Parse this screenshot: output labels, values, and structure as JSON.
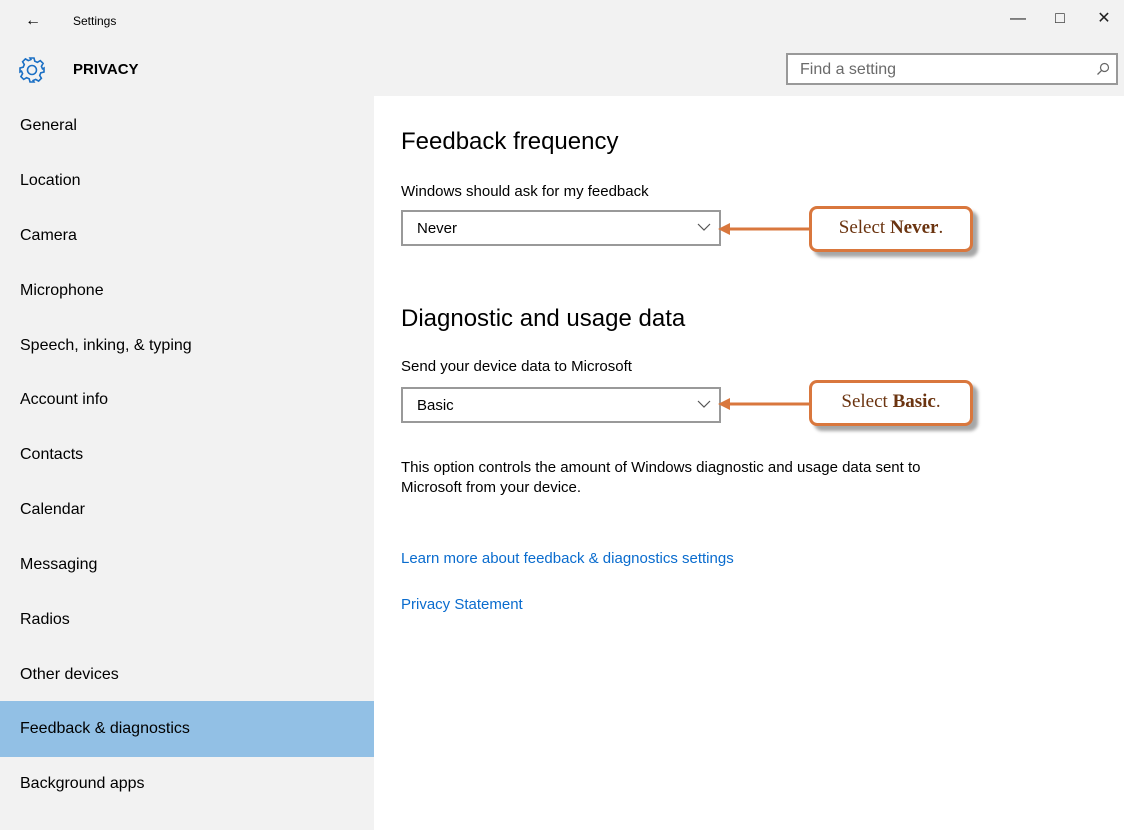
{
  "window": {
    "title": "Settings",
    "back_icon": "←",
    "minimize_icon": "—",
    "maximize_icon": "□",
    "close_icon": "✕"
  },
  "header": {
    "icon": "gear-icon",
    "title": "PRIVACY",
    "search": {
      "placeholder": "Find a setting",
      "icon": "search-icon"
    }
  },
  "sidebar": {
    "items": [
      {
        "label": "General"
      },
      {
        "label": "Location"
      },
      {
        "label": "Camera"
      },
      {
        "label": "Microphone"
      },
      {
        "label": "Speech, inking, & typing"
      },
      {
        "label": "Account info"
      },
      {
        "label": "Contacts"
      },
      {
        "label": "Calendar"
      },
      {
        "label": "Messaging"
      },
      {
        "label": "Radios"
      },
      {
        "label": "Other devices"
      },
      {
        "label": "Feedback & diagnostics",
        "selected": true
      },
      {
        "label": "Background apps"
      }
    ]
  },
  "main": {
    "feedback": {
      "heading": "Feedback frequency",
      "label": "Windows should ask for my feedback",
      "value": "Never"
    },
    "diagnostics": {
      "heading": "Diagnostic and usage data",
      "label": "Send your device data to Microsoft",
      "value": "Basic",
      "description": "This option controls the amount of Windows diagnostic and usage data sent to Microsoft from your device."
    },
    "links": {
      "learn_more": "Learn more about feedback & diagnostics settings",
      "privacy": "Privacy Statement"
    }
  },
  "callouts": {
    "never": {
      "prefix": "Select ",
      "bold": "Never",
      "suffix": "."
    },
    "basic": {
      "prefix": "Select ",
      "bold": "Basic",
      "suffix": "."
    }
  },
  "colors": {
    "chrome_bg": "#f2f2f2",
    "selected_item": "#92c0e5",
    "link": "#0a6cce",
    "callout_border": "#d9773d",
    "callout_text": "#6b3410"
  }
}
